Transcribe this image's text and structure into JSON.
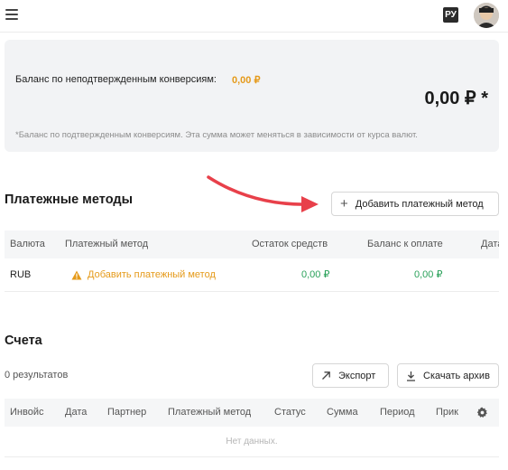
{
  "header": {
    "menu_icon": "hamburger-icon",
    "lang": "РУ",
    "avatar_icon": "user-avatar"
  },
  "balance": {
    "label": "Баланс по неподтвержденным конверсиям:",
    "unconfirmed": "0,00 ₽",
    "total": "0,00 ₽ *",
    "note": "*Баланс по подтвержденным конверсиям. Эта сумма может меняться в зависимости от курса валют."
  },
  "payment_methods": {
    "title": "Платежные методы",
    "add_button": "Добавить платежный метод",
    "columns": [
      "Валюта",
      "Платежный метод",
      "Остаток средств",
      "Баланс к оплате",
      "Дата"
    ],
    "rows": [
      {
        "currency": "RUB",
        "method_link": "Добавить платежный метод",
        "remaining": "0,00 ₽",
        "payable": "0,00 ₽"
      }
    ]
  },
  "accounts": {
    "title": "Счета",
    "results": "0 результатов",
    "export_button": "Экспорт",
    "archive_button": "Скачать архив",
    "columns": [
      "Инвойс",
      "Дата",
      "Партнер",
      "Платежный метод",
      "Статус",
      "Сумма",
      "Период",
      "Прик"
    ],
    "empty": "Нет данных."
  },
  "colors": {
    "accent": "#e59a1a",
    "positive": "#2aa15a",
    "arrow": "#e8404a"
  }
}
